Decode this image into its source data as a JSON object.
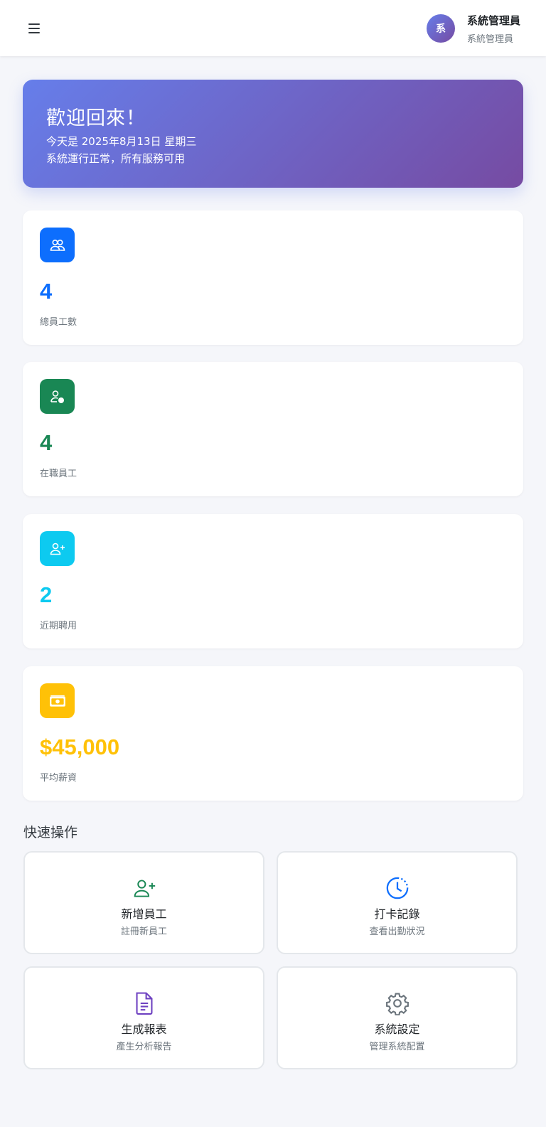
{
  "header": {
    "menu_icon": "hamburger-icon",
    "avatar_text": "系",
    "user_name": "系統管理員",
    "user_role": "系統管理員"
  },
  "welcome": {
    "title": "歡迎回來！",
    "date_line": "今天是 2025年8月13日 星期三",
    "status_line": "系統運行正常，所有服務可用",
    "gradient": [
      "#667eea",
      "#764ba2"
    ]
  },
  "stats": [
    {
      "value": "4",
      "label": "總員工數",
      "icon": "people-icon",
      "color": "#0d6efd"
    },
    {
      "value": "4",
      "label": "在職員工",
      "icon": "person-check-icon",
      "color": "#198754"
    },
    {
      "value": "2",
      "label": "近期聘用",
      "icon": "person-add-icon",
      "color": "#0dcaf0"
    },
    {
      "value": "$45,000",
      "label": "平均薪資",
      "icon": "cash-icon",
      "color": "#ffc107"
    }
  ],
  "quick_actions": {
    "title": "快速操作",
    "items": [
      {
        "title": "新增員工",
        "subtitle": "註冊新員工",
        "icon": "person-add-icon",
        "color": "#198754"
      },
      {
        "title": "打卡記錄",
        "subtitle": "查看出勤狀況",
        "icon": "clock-icon",
        "color": "#0d6efd"
      },
      {
        "title": "生成報表",
        "subtitle": "產生分析報告",
        "icon": "document-icon",
        "color": "#6f42c1"
      },
      {
        "title": "系統設定",
        "subtitle": "管理系統配置",
        "icon": "gear-icon",
        "color": "#6c757d"
      }
    ]
  }
}
